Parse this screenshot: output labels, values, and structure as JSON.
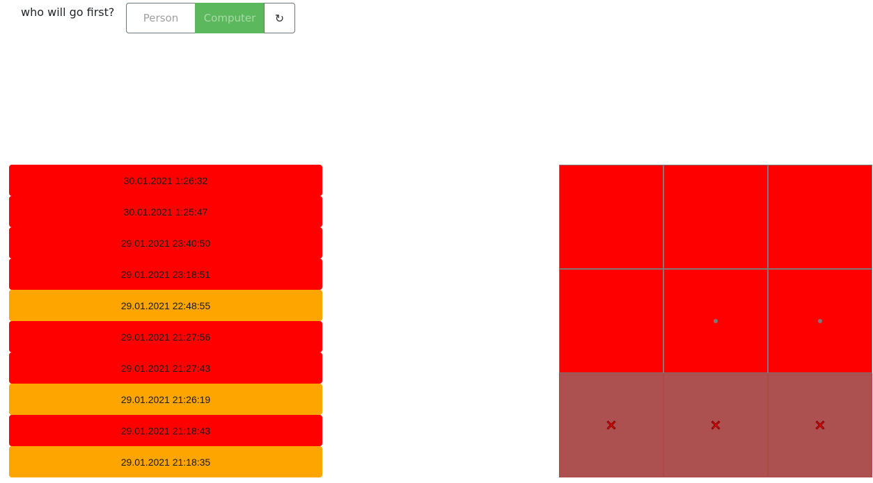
{
  "header": {
    "question": "who will go first?",
    "person_label": "Person",
    "computer_label": "Computer",
    "reset_icon": "↻"
  },
  "colors": {
    "loss": "#ff0000",
    "draw": "#ffa500",
    "win_line": "#ad5050",
    "selected": "#5cb85c"
  },
  "history": [
    {
      "label": "30.01.2021 1:26:32",
      "result": "loss"
    },
    {
      "label": "30.01.2021 1:25:47",
      "result": "loss"
    },
    {
      "label": "29.01.2021 23:40:50",
      "result": "loss"
    },
    {
      "label": "29.01.2021 23:18:51",
      "result": "loss"
    },
    {
      "label": "29.01.2021 22:48:55",
      "result": "draw"
    },
    {
      "label": "29.01.2021 21:27:56",
      "result": "loss"
    },
    {
      "label": "29.01.2021 21:27:43",
      "result": "loss"
    },
    {
      "label": "29.01.2021 21:26:19",
      "result": "draw"
    },
    {
      "label": "29.01.2021 21:18:43",
      "result": "loss"
    },
    {
      "label": "29.01.2021 21:18:35",
      "result": "draw"
    }
  ],
  "board": [
    {
      "mark": "",
      "win": false
    },
    {
      "mark": "",
      "win": false
    },
    {
      "mark": "",
      "win": false
    },
    {
      "mark": "",
      "win": false
    },
    {
      "mark": "O",
      "win": false
    },
    {
      "mark": "O",
      "win": false
    },
    {
      "mark": "X",
      "win": true
    },
    {
      "mark": "X",
      "win": true
    },
    {
      "mark": "X",
      "win": true
    }
  ]
}
